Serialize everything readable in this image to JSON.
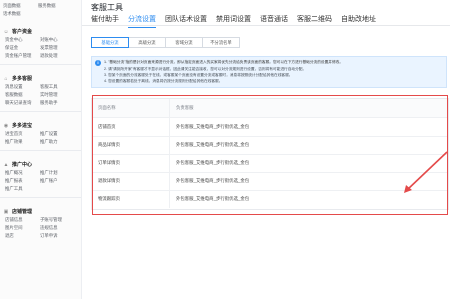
{
  "sidebar": {
    "top_rows": [
      [
        "页面数据",
        "服务数据"
      ],
      [
        "话术数据",
        ""
      ]
    ],
    "groups": [
      {
        "icon": "user-icon",
        "title": "客户资金",
        "rows": [
          [
            "资金中心",
            "对账中心"
          ],
          [
            "保证金",
            "发票管理"
          ],
          [
            "资金账户管理",
            "退款处理"
          ]
        ]
      },
      {
        "icon": "home-icon",
        "title": "多多客服",
        "rows": [
          [
            "消息设置",
            "客服工具"
          ],
          [
            "客服数据",
            "实时管理"
          ],
          [
            "聊天记录查询",
            "服务助手"
          ]
        ]
      },
      {
        "icon": "tag-icon",
        "title": "多多进宝",
        "rows": [
          [
            "进宝首页",
            "推广设置"
          ],
          [
            "推广效果",
            "推广助力"
          ]
        ]
      },
      {
        "icon": "chart-icon",
        "title": "推广中心",
        "rows": [
          [
            "推广概况",
            "推广计划"
          ],
          [
            "推广报表",
            "推广账户"
          ],
          [
            "推广工具",
            ""
          ]
        ]
      },
      {
        "icon": "store-icon",
        "title": "店铺管理",
        "rows": [
          [
            "店铺信息",
            "子账号管理"
          ],
          [
            "图片空间",
            "违规信息"
          ],
          [
            "退店",
            "订单申诉"
          ]
        ]
      }
    ]
  },
  "page": {
    "title": "客服工具"
  },
  "top_tabs": [
    {
      "label": "催付助手",
      "active": false
    },
    {
      "label": "分流设置",
      "active": true
    },
    {
      "label": "团队话术设置",
      "active": false
    },
    {
      "label": "禁用词设置",
      "active": false
    },
    {
      "label": "语音通话",
      "active": false
    },
    {
      "label": "客服二维码",
      "active": false
    },
    {
      "label": "自助改地址",
      "active": false
    }
  ],
  "sub_tabs": [
    {
      "label": "基础分流",
      "active": true
    },
    {
      "label": "高级分流",
      "active": false
    },
    {
      "label": "客域分流",
      "active": false
    },
    {
      "label": "不分流名单",
      "active": false
    }
  ],
  "notice": {
    "lines": [
      "1. \"基础分流\"指的是针对页面来源进行分流，即从指定页面进入的买家将优先分流给负责该页面的客服。您可以在下方进行基础分流的设置并修改。",
      "2. 请\"请到所开家\"有客服才不显示对话框，因此请关注能否接收，您可以对分流规则进行设置，否则将有可能进行自动分配。",
      "3. 您某个页面的分流客服处于在线，或客服某个页面没有设置分流或客服时，消息将按照统计分配给其他在线客服。",
      "4. 您设置的客服若处于离线，消息将仍按分流规则分配给其他在线客服。"
    ]
  },
  "table": {
    "headers": [
      "页面名称",
      "负责客服"
    ],
    "rows": [
      [
        "店铺首页",
        "外包客服_艾维电商_步行街优选_金包"
      ],
      [
        "商品详情页",
        "外包客服_艾维电商_步行街优选_金包"
      ],
      [
        "订单详情页",
        "外包客服_艾维电商_步行街优选_金包"
      ],
      [
        "退款详情页",
        "外包客服_艾维电商_步行街优选_金包"
      ],
      [
        "物流跟踪页",
        "外包客服_艾维电商_步行街优选_金包"
      ]
    ]
  },
  "colors": {
    "accent": "#2d8cf0",
    "highlight": "#e44a4a"
  }
}
